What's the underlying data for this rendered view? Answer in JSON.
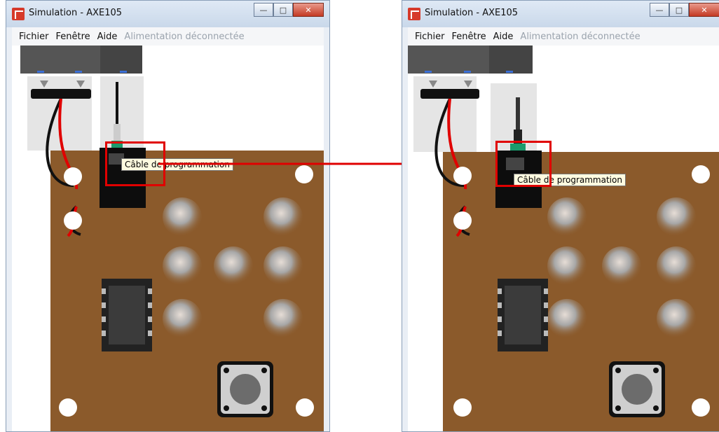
{
  "windows": [
    {
      "title": "Simulation - AXE105",
      "menu": [
        "Fichier",
        "Fenêtre",
        "Aide"
      ],
      "status": "Alimentation déconnectée",
      "tooltip": "Câble de programmation",
      "cable_plugged": true
    },
    {
      "title": "Simulation - AXE105",
      "menu": [
        "Fichier",
        "Fenêtre",
        "Aide"
      ],
      "status": "Alimentation déconnectée",
      "tooltip": "Câble de programmation",
      "cable_plugged": false
    }
  ],
  "colors": {
    "board": "#8b5a2b",
    "highlight": "#e00000",
    "tooltip_bg": "#fffbe0"
  },
  "icons": {
    "app": "simulation-app-icon",
    "minimize": "minimize-icon",
    "maximize": "maximize-icon",
    "close": "close-icon"
  }
}
